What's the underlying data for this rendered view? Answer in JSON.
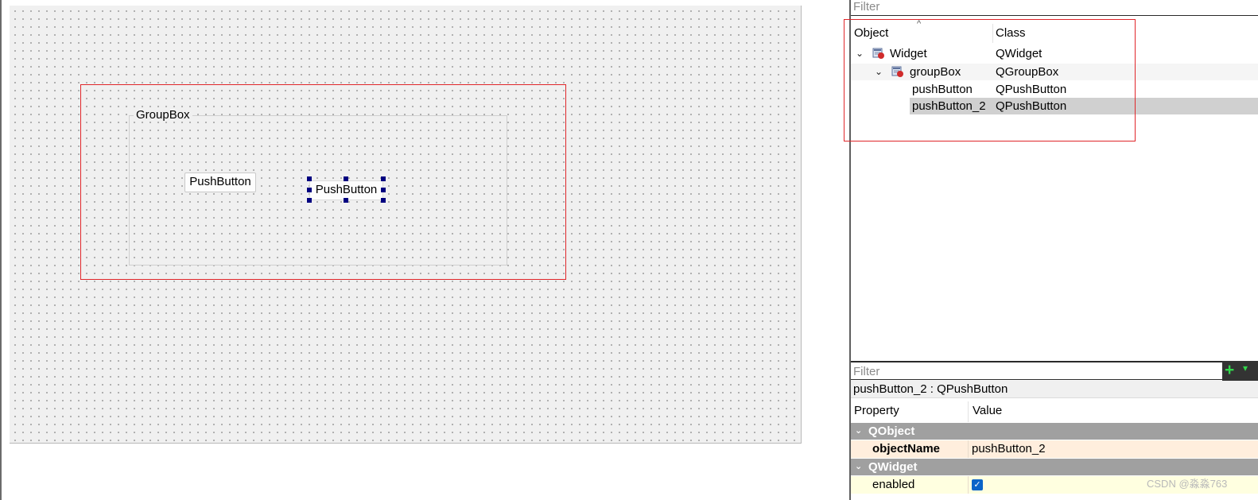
{
  "designer": {
    "groupbox_title": "GroupBox",
    "button1_label": "PushButton",
    "button2_label": "PushButton"
  },
  "object_inspector": {
    "filter_placeholder": "Filter",
    "sort_indicator": "^",
    "columns": [
      "Object",
      "Class"
    ],
    "rows": [
      {
        "name": "Widget",
        "class": "QWidget",
        "expand_icon": "chevron-down-icon",
        "icon": "widget-icon"
      },
      {
        "name": "groupBox",
        "class": "QGroupBox",
        "expand_icon": "chevron-down-icon",
        "icon": "widget-icon"
      },
      {
        "name": "pushButton",
        "class": "QPushButton"
      },
      {
        "name": "pushButton_2",
        "class": "QPushButton",
        "selected": true
      }
    ]
  },
  "property_editor": {
    "filter_placeholder": "Filter",
    "add_icon": "+",
    "more_icon": "▾",
    "object_title": "pushButton_2 : QPushButton",
    "columns": [
      "Property",
      "Value"
    ],
    "categories": [
      {
        "name": "QObject",
        "properties": [
          {
            "name": "objectName",
            "value": "pushButton_2"
          }
        ]
      },
      {
        "name": "QWidget",
        "properties": [
          {
            "name": "enabled",
            "value": "✓"
          }
        ]
      }
    ]
  },
  "watermark": "CSDN @淼淼763",
  "colors": {
    "highlight_border": "#e0262a",
    "selection_handle": "#000080",
    "category_bg": "#a0a0a0",
    "checkbox": "#0a64c8"
  }
}
